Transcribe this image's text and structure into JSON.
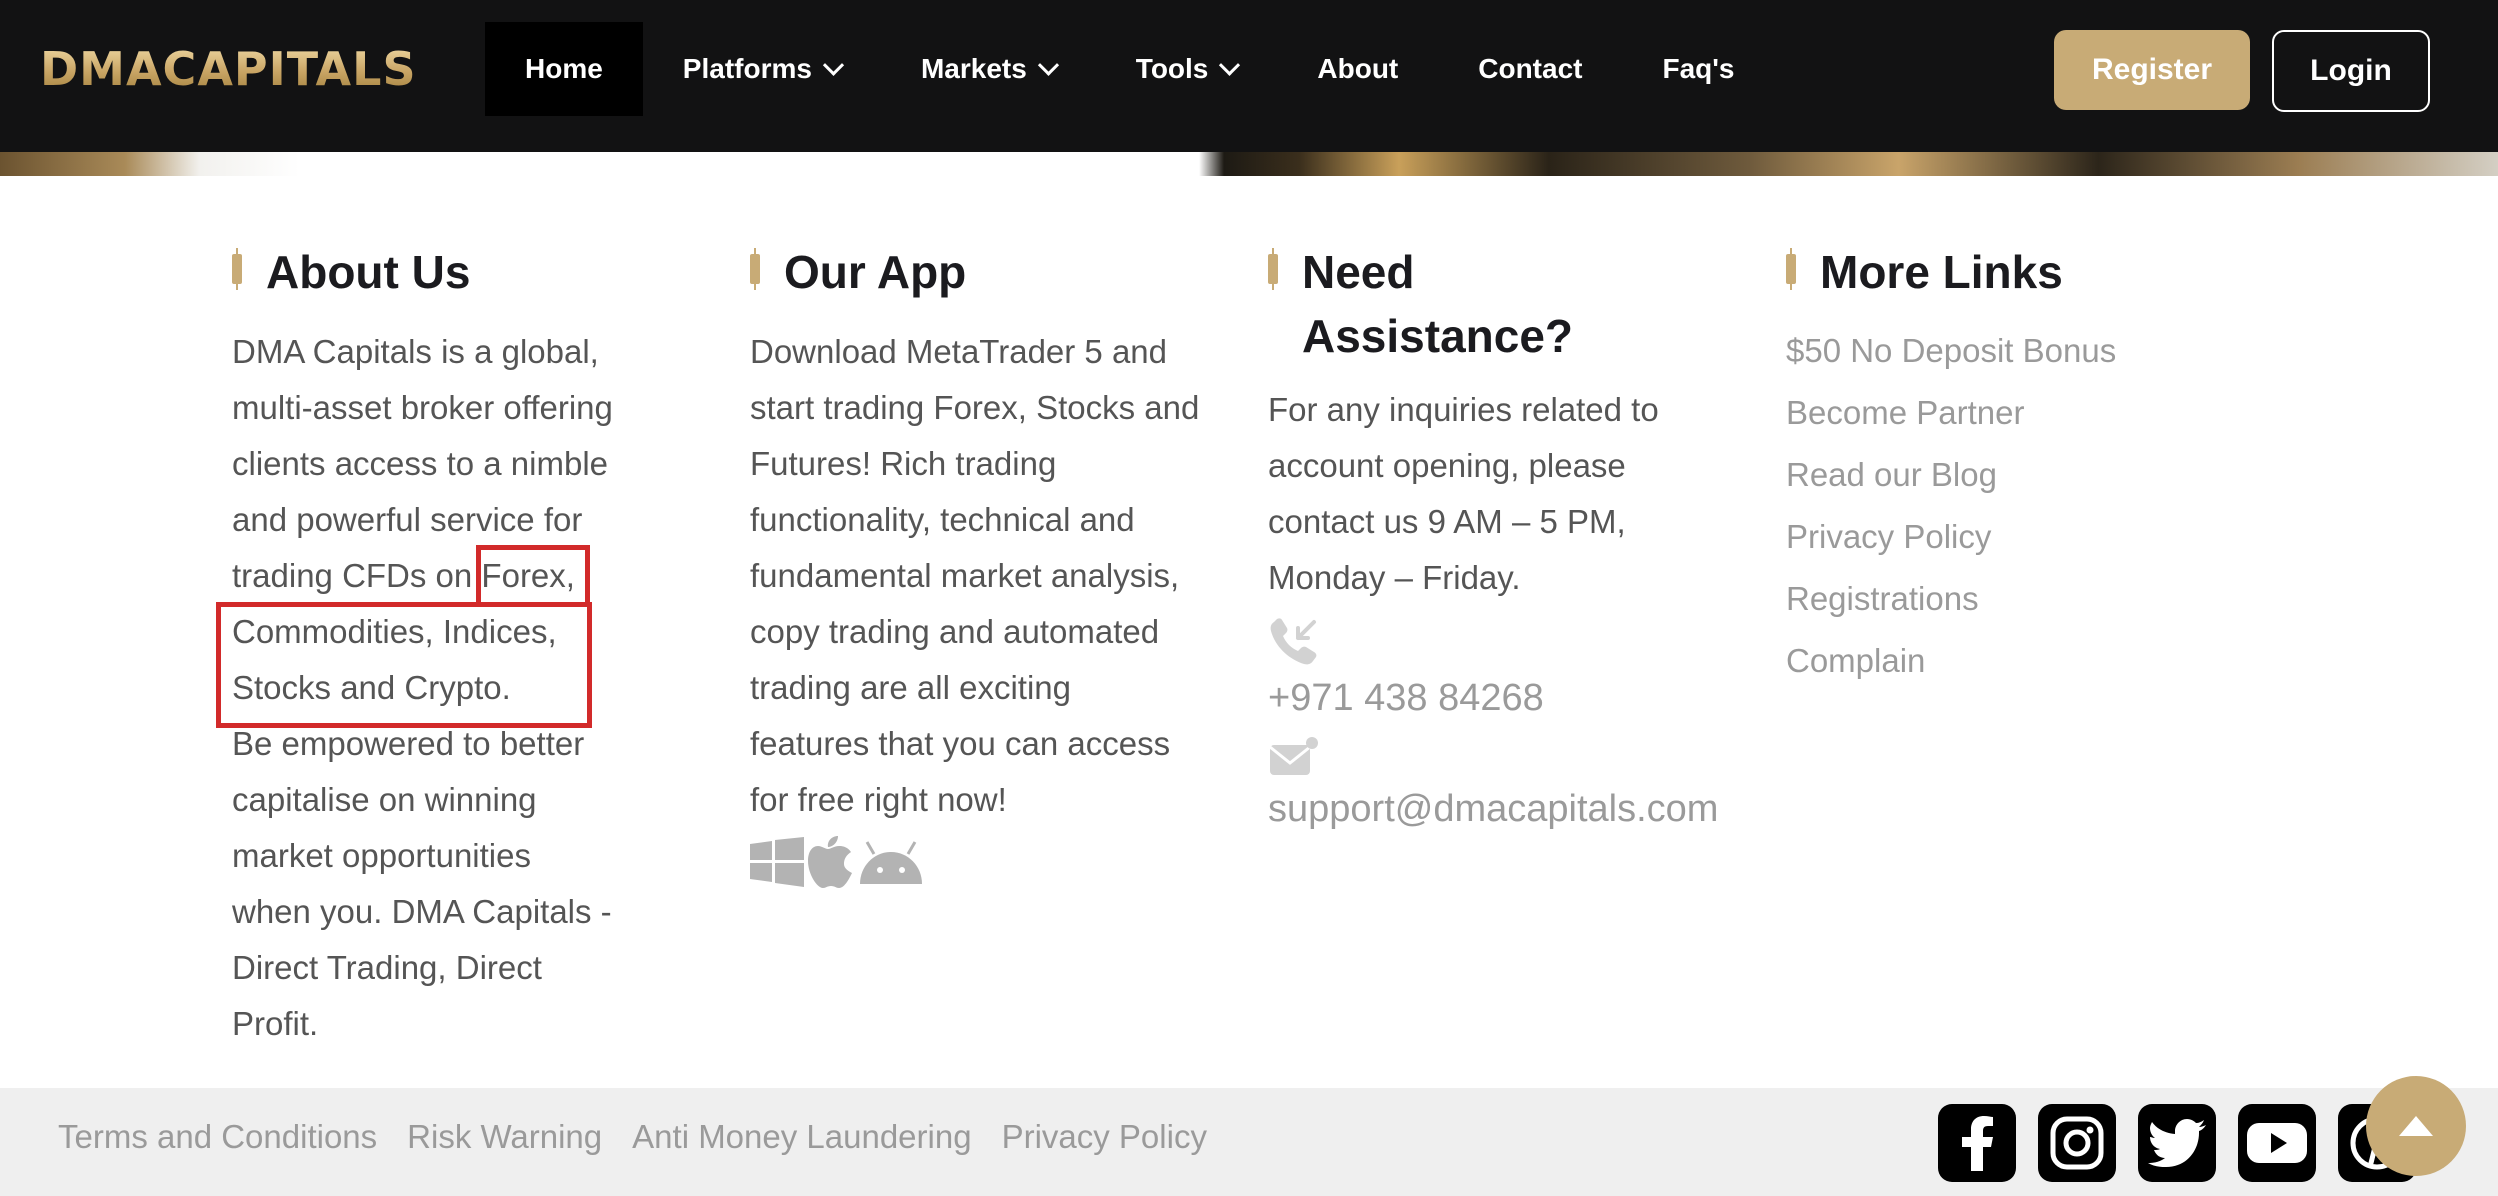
{
  "header": {
    "logo_text": "DMACAPITALS",
    "nav": [
      {
        "label": "Home",
        "active": true,
        "dropdown": false
      },
      {
        "label": "Platforms",
        "dropdown": true
      },
      {
        "label": "Markets",
        "dropdown": true
      },
      {
        "label": "Tools",
        "dropdown": true
      },
      {
        "label": "About",
        "dropdown": false
      },
      {
        "label": "Contact",
        "dropdown": false
      },
      {
        "label": "Faq's",
        "dropdown": false
      }
    ],
    "register_label": "Register",
    "login_label": "Login"
  },
  "about": {
    "title": "About Us",
    "lines": [
      "DMA Capitals is a global,",
      "multi-asset broker offering",
      "clients access to a nimble",
      "and powerful service for",
      "trading CFDs on Forex,",
      "Commodities, Indices,",
      "Stocks and Crypto.",
      "Be empowered to better",
      "capitalise on winning",
      "market opportunities",
      "when you. DMA Capitals -",
      "Direct Trading, Direct",
      "Profit."
    ]
  },
  "app": {
    "title": "Our App",
    "lines": [
      "Download MetaTrader 5 and",
      "start trading Forex, Stocks and",
      "Futures! Rich trading",
      "functionality, technical and",
      "fundamental market analysis,",
      "copy trading and automated",
      "trading are all exciting",
      "features that you can access",
      "for free right now!"
    ],
    "platform_icons": [
      "windows-icon",
      "apple-icon",
      "android-icon"
    ]
  },
  "assist": {
    "title_line1": "Need",
    "title_line2": "Assistance?",
    "lines": [
      "For any inquiries related to",
      "account opening, please",
      "contact us 9 AM – 5 PM,",
      "Monday – Friday."
    ],
    "phone": "+971 438 84268",
    "email": "support@dmacapitals.com"
  },
  "more_links": {
    "title": "More Links",
    "items": [
      "$50 No Deposit Bonus",
      "Become Partner",
      "Read our Blog",
      "Privacy Policy",
      "Registrations",
      "Complain"
    ]
  },
  "bottom": {
    "links": [
      "Terms and Conditions",
      "Risk Warning",
      "Anti Money Laundering",
      "Privacy Policy"
    ],
    "social": [
      "facebook-icon",
      "instagram-icon",
      "twitter-icon",
      "youtube-icon",
      "pinterest-icon"
    ]
  },
  "colors": {
    "accent": "#c8ab76",
    "header_bg": "#121213",
    "highlight": "#d22a2a"
  }
}
